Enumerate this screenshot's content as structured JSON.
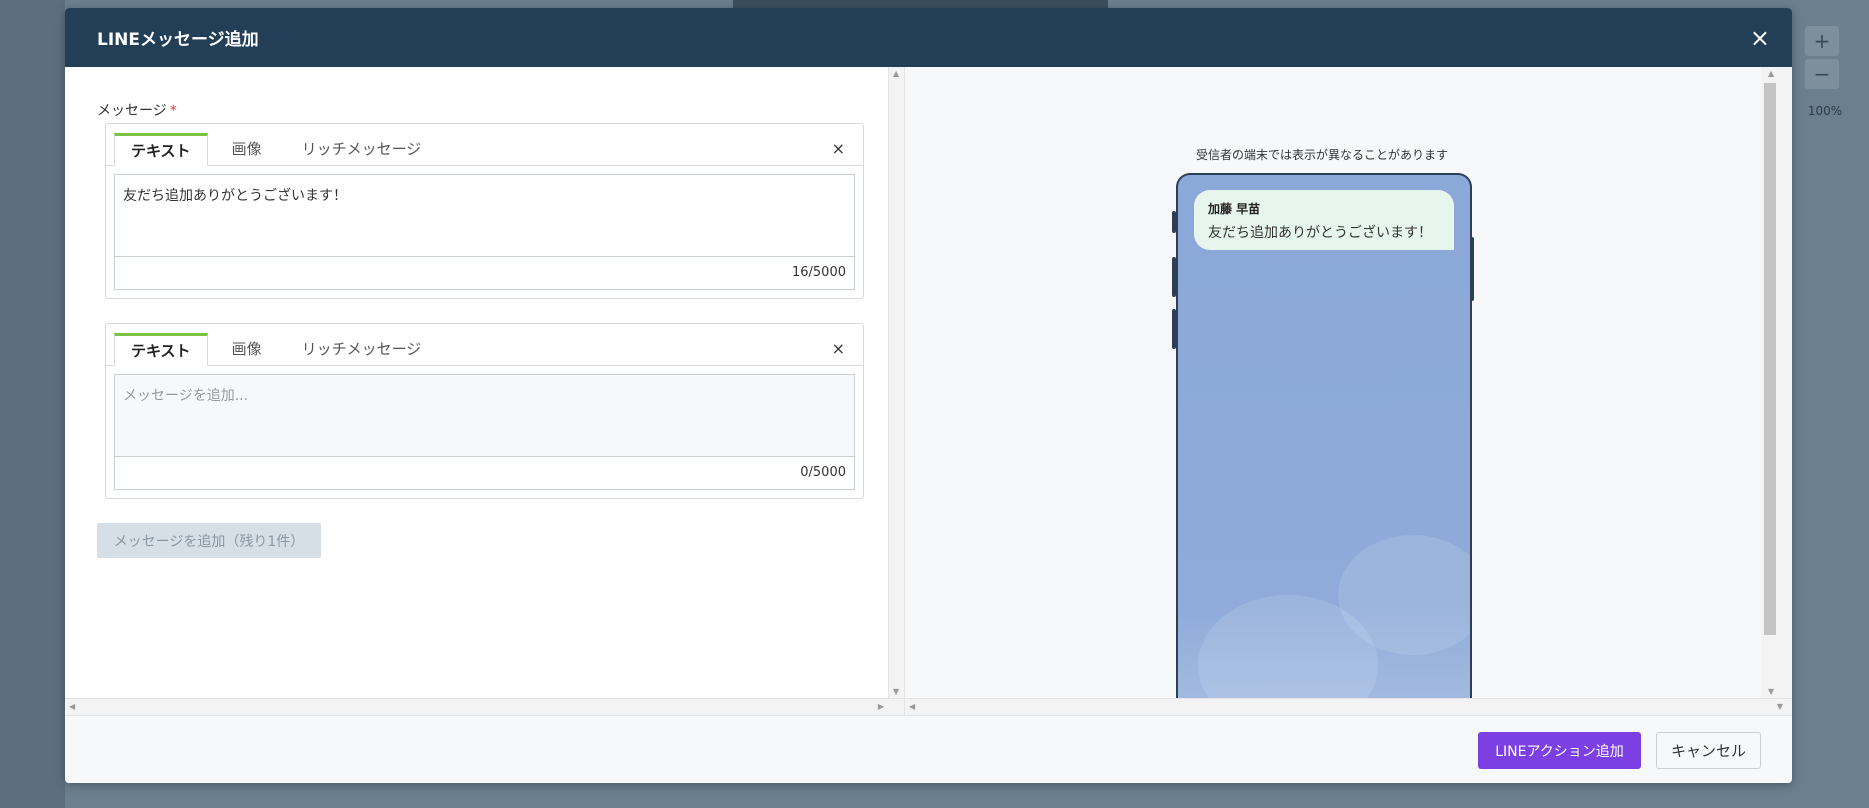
{
  "zoom": {
    "plus": "+",
    "minus": "−",
    "level": "100%"
  },
  "modal": {
    "title": "LINEメッセージ追加",
    "close_icon": "×"
  },
  "form": {
    "message_label": "メッセージ",
    "required_mark": "*",
    "cards": [
      {
        "tabs": [
          "テキスト",
          "画像",
          "リッチメッセージ"
        ],
        "active_tab": "テキスト",
        "close": "×",
        "value": "友だち追加ありがとうございます！",
        "counter": "16/5000"
      },
      {
        "tabs": [
          "テキスト",
          "画像",
          "リッチメッセージ"
        ],
        "active_tab": "テキスト",
        "close": "×",
        "placeholder": "メッセージを追加...",
        "counter": "0/5000"
      }
    ],
    "add_message_button": "メッセージを追加（残り1件）"
  },
  "preview": {
    "note": "受信者の端末では表示が異なることがあります",
    "sender": "加藤 早苗",
    "message": "友だち追加ありがとうございます！"
  },
  "footer": {
    "primary_label": "LINEアクション追加",
    "cancel_label": "キャンセル"
  },
  "colors": {
    "header_bg": "#233f57",
    "tab_active_accent": "#7cc242",
    "primary_button": "#7b3fe4",
    "bubble_bg": "#e7f5ef",
    "phone_bg": "#8aa8d8"
  }
}
